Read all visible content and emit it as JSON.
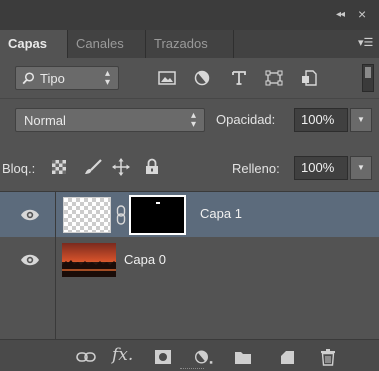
{
  "tabs": [
    {
      "label": "Capas",
      "active": true
    },
    {
      "label": "Canales",
      "active": false
    },
    {
      "label": "Trazados",
      "active": false
    }
  ],
  "top_controls": {
    "collapse_icon": "double-chevron-left-icon",
    "close_icon": "close-icon",
    "menu_icon": "panel-menu-icon"
  },
  "filter": {
    "label": "Tipo",
    "icons": [
      "pixel-filter-icon",
      "adjustment-filter-icon",
      "type-filter-icon",
      "shape-filter-icon",
      "smart-object-filter-icon"
    ]
  },
  "blend": {
    "mode": "Normal",
    "opacity_label": "Opacidad:",
    "opacity_value": "100%"
  },
  "lock": {
    "label": "Bloq.:",
    "fill_label": "Relleno:",
    "fill_value": "100%"
  },
  "layers": [
    {
      "name": "Capa 1",
      "selected": true,
      "visible": true,
      "has_mask": true
    },
    {
      "name": "Capa 0",
      "selected": false,
      "visible": true,
      "has_mask": false
    }
  ],
  "bottom_icons": [
    "link-layers-icon",
    "fx-icon",
    "add-mask-icon",
    "adjustment-layer-icon",
    "new-group-icon",
    "new-layer-icon",
    "delete-icon"
  ],
  "colors": {
    "panel": "#535353",
    "selected_layer": "#5c6b7c",
    "dark_strip": "#3c3c3c"
  }
}
